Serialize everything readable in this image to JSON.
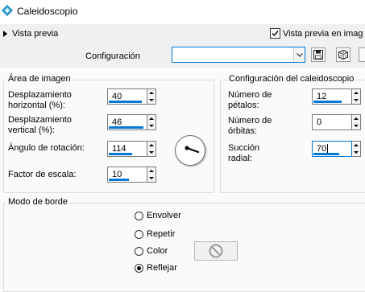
{
  "window": {
    "title": "Caleidoscopio",
    "icon": "kaleidoscope-app-icon"
  },
  "preview": {
    "toggle_label": "Vista previa",
    "live_label": "Vista previa en imag",
    "live_checked": true
  },
  "config": {
    "label": "Configuración",
    "value": ""
  },
  "image_area": {
    "title": "Área de imagen",
    "h_offset": {
      "label_line1": "Desplazamiento",
      "label_line2": "horizontal (%):",
      "value": "40",
      "level": 0.9
    },
    "v_offset": {
      "label_line1": "Desplazamiento",
      "label_line2": "vertical (%):",
      "value": "46",
      "level": 0.94
    },
    "rotation": {
      "label": "Ángulo de rotación:",
      "value": "114",
      "level": 0.63
    },
    "scale": {
      "label": "Factor de escala:",
      "value": "10",
      "level": 0.55
    }
  },
  "kaleido": {
    "title": "Configuración del caleidoscopio",
    "petals": {
      "label_line1": "Número de",
      "label_line2": "pétalos:",
      "value": "12",
      "level": 0.75
    },
    "orbits": {
      "label_line1": "Número de",
      "label_line2": "órbitas:",
      "value": "0",
      "level": 0
    },
    "suction": {
      "label_line1": "Succión",
      "label_line2": "radial:",
      "value": "70",
      "level": 0.7
    }
  },
  "border_mode": {
    "title": "Modo de borde",
    "options": [
      {
        "label": "Envolver",
        "selected": false
      },
      {
        "label": "Repetir",
        "selected": false
      },
      {
        "label": "Color",
        "selected": false
      },
      {
        "label": "Reflejar",
        "selected": true
      }
    ]
  },
  "colors": {
    "accent": "#0078d7",
    "window_bg": "#f0f0f0",
    "panel_bg": "#fafafa"
  }
}
